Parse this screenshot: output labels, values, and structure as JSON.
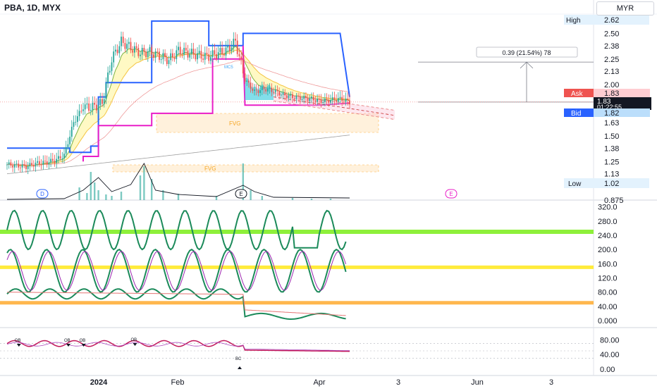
{
  "symbol": "PBA, 1D, MYX",
  "currency": "MYR",
  "price_panel": {
    "high_label": "High",
    "high_value": "2.62",
    "low_label": "Low",
    "low_value": "1.02",
    "ask_label": "Ask",
    "ask_value": "1.83",
    "bid_label": "Bid",
    "bid_value": "1.82",
    "last_price": "1.83",
    "countdown": "01:22:55",
    "measure_label": "0.39 (21.54%) 78",
    "fvg_label": "FVG",
    "ma_label": "MC5",
    "event_badges": [
      "D",
      "E",
      "E"
    ]
  },
  "axis_main": [
    "2.50",
    "2.38",
    "2.25",
    "2.13",
    "2.00",
    "1.88",
    "1.75",
    "1.63",
    "1.50",
    "1.38",
    "1.25",
    "1.13",
    "0.875"
  ],
  "axis_osc": [
    "320.0",
    "280.0",
    "240.0",
    "200.0",
    "160.0",
    "120.0",
    "80.00",
    "40.00",
    "0.000"
  ],
  "axis_bottom": [
    "80.00",
    "40.00",
    "0.00"
  ],
  "x_labels": [
    "2024",
    "Feb",
    "Apr",
    "3",
    "Jun",
    "3"
  ],
  "bottom_markers": [
    "OB",
    "OB",
    "OB",
    "OB",
    "BC"
  ],
  "colors": {
    "up": "#26a69a",
    "down": "#ef5350",
    "blue": "#2962ff",
    "magenta": "#e91ec8",
    "green_line": "#8ef03a",
    "yellow_line": "#ffeb3b",
    "orange_line": "#ffb74d"
  },
  "chart_data": [
    {
      "type": "line",
      "title": "PBA, 1D, MYX",
      "x_ticks": [
        "2024",
        "Feb",
        "Apr",
        "3",
        "Jun",
        "3"
      ],
      "y_ticks": [
        0.875,
        1.13,
        1.25,
        1.38,
        1.5,
        1.63,
        1.75,
        1.88,
        2.0,
        2.13,
        2.25,
        2.38,
        2.5
      ],
      "ylim": [
        0.86,
        2.66
      ],
      "series": [
        {
          "name": "Close",
          "x": [
            0,
            5,
            10,
            15,
            20,
            25,
            30,
            35,
            40,
            45,
            50,
            55,
            60,
            65,
            70,
            75,
            80,
            85,
            90,
            95,
            100,
            105,
            110,
            115,
            120,
            125,
            130,
            135,
            140,
            145,
            150,
            155,
            160,
            165,
            170,
            175,
            180
          ],
          "values": [
            1.22,
            1.21,
            1.2,
            1.23,
            1.24,
            1.26,
            1.31,
            1.63,
            1.78,
            1.78,
            1.82,
            2.25,
            2.42,
            2.36,
            2.31,
            2.32,
            2.28,
            2.24,
            2.33,
            2.31,
            2.29,
            2.27,
            2.3,
            2.33,
            2.42,
            2.05,
            1.93,
            1.96,
            1.94,
            1.9,
            1.88,
            1.87,
            1.86,
            1.84,
            1.85,
            1.86,
            1.83
          ]
        }
      ],
      "high": 2.62,
      "low": 1.02,
      "ask": 1.83,
      "bid": 1.82
    },
    {
      "type": "line",
      "y_ticks": [
        0,
        40,
        80,
        120,
        160,
        200,
        240,
        280,
        320
      ],
      "ylim": [
        -10,
        325
      ],
      "reference_lines": [
        250,
        150,
        50
      ]
    },
    {
      "type": "line",
      "y_ticks": [
        0,
        40,
        80
      ],
      "ylim": [
        0,
        95
      ]
    }
  ]
}
